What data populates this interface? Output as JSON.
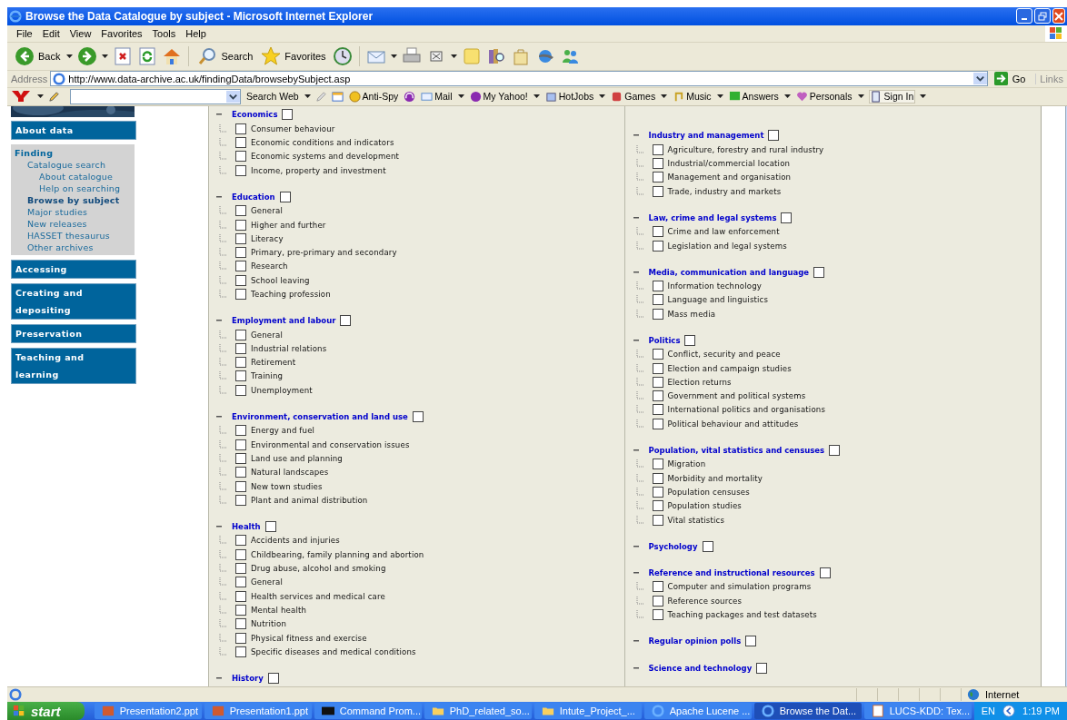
{
  "window": {
    "title": "Browse the Data Catalogue by subject - Microsoft Internet Explorer"
  },
  "menu": [
    "File",
    "Edit",
    "View",
    "Favorites",
    "Tools",
    "Help"
  ],
  "toolbar": {
    "back": "Back",
    "search": "Search",
    "favorites": "Favorites"
  },
  "address": {
    "label": "Address",
    "value": "http://www.data-archive.ac.uk/findingData/browsebySubject.asp",
    "go": "Go",
    "links": "Links"
  },
  "yahoo_toolbar": {
    "search_button": "Search Web",
    "buttons": [
      {
        "label": "Anti-Spy",
        "kind": "antispy",
        "dropdown": false
      },
      {
        "label": "Mail",
        "kind": "mail",
        "dropdown": true
      },
      {
        "label": "My Yahoo!",
        "kind": "my",
        "dropdown": true
      },
      {
        "label": "HotJobs",
        "kind": "jobs",
        "dropdown": true
      },
      {
        "label": "Games",
        "kind": "games",
        "dropdown": true
      },
      {
        "label": "Music",
        "kind": "music",
        "dropdown": true
      },
      {
        "label": "Answers",
        "kind": "answers",
        "dropdown": true
      },
      {
        "label": "Personals",
        "kind": "personals",
        "dropdown": true
      },
      {
        "label": "Sign In",
        "kind": "signin",
        "dropdown": true
      }
    ]
  },
  "sidebar": {
    "sections": [
      {
        "kind": "tab",
        "label": "About data"
      },
      {
        "kind": "group",
        "label": "Finding",
        "links": [
          {
            "label": "Catalogue search",
            "selected": false,
            "children": [
              {
                "label": "About catalogue",
                "selected": false
              },
              {
                "label": "Help on searching",
                "selected": false
              }
            ]
          },
          {
            "label": "Browse by subject",
            "selected": true
          },
          {
            "label": "Major studies",
            "selected": false
          },
          {
            "label": "New releases",
            "selected": false
          },
          {
            "label": "HASSET thesaurus",
            "selected": false
          },
          {
            "label": "Other archives",
            "selected": false
          }
        ]
      },
      {
        "kind": "tab",
        "label": "Accessing"
      },
      {
        "kind": "tab",
        "label": "Creating and depositing"
      },
      {
        "kind": "tab",
        "label": "Preservation"
      },
      {
        "kind": "tab",
        "label": "Teaching and learning"
      }
    ]
  },
  "columns": [
    {
      "categories": [
        {
          "title": "Economics",
          "checked": false,
          "items": [
            {
              "label": "Consumer behaviour",
              "checked": false
            },
            {
              "label": "Economic conditions and indicators",
              "checked": false
            },
            {
              "label": "Economic systems and development",
              "checked": false
            },
            {
              "label": "Income, property and investment",
              "checked": false
            }
          ]
        },
        {
          "title": "Education",
          "checked": false,
          "items": [
            {
              "label": "General",
              "checked": false
            },
            {
              "label": "Higher and further",
              "checked": false
            },
            {
              "label": "Literacy",
              "checked": false
            },
            {
              "label": "Primary, pre-primary and secondary",
              "checked": false
            },
            {
              "label": "Research",
              "checked": false
            },
            {
              "label": "School leaving",
              "checked": false
            },
            {
              "label": "Teaching profession",
              "checked": false
            }
          ]
        },
        {
          "title": "Employment and labour",
          "checked": false,
          "items": [
            {
              "label": "General",
              "checked": false
            },
            {
              "label": "Industrial relations",
              "checked": false
            },
            {
              "label": "Retirement",
              "checked": false
            },
            {
              "label": "Training",
              "checked": false
            },
            {
              "label": "Unemployment",
              "checked": false
            }
          ]
        },
        {
          "title": "Environment, conservation and land use",
          "checked": false,
          "items": [
            {
              "label": "Energy and fuel",
              "checked": false
            },
            {
              "label": "Environmental and conservation issues",
              "checked": false
            },
            {
              "label": "Land use and planning",
              "checked": false
            },
            {
              "label": "Natural landscapes",
              "checked": false
            },
            {
              "label": "New town studies",
              "checked": false
            },
            {
              "label": "Plant and animal distribution",
              "checked": false
            }
          ]
        },
        {
          "title": "Health",
          "checked": false,
          "items": [
            {
              "label": "Accidents and injuries",
              "checked": false
            },
            {
              "label": "Childbearing, family planning and abortion",
              "checked": false
            },
            {
              "label": "Drug abuse, alcohol and smoking",
              "checked": false
            },
            {
              "label": "General",
              "checked": false
            },
            {
              "label": "Health services and medical care",
              "checked": false
            },
            {
              "label": "Mental health",
              "checked": false
            },
            {
              "label": "Nutrition",
              "checked": false
            },
            {
              "label": "Physical fitness and exercise",
              "checked": false
            },
            {
              "label": "Specific diseases and medical conditions",
              "checked": false
            }
          ]
        },
        {
          "title": "History",
          "checked": false
        }
      ]
    },
    {
      "categories": [
        {
          "title": "Industry and management",
          "checked": false,
          "items": [
            {
              "label": "Agriculture, forestry and rural industry",
              "checked": false
            },
            {
              "label": "Industrial/commercial location",
              "checked": false
            },
            {
              "label": "Management and organisation",
              "checked": false
            },
            {
              "label": "Trade, industry and markets",
              "checked": false
            }
          ]
        },
        {
          "title": "Law, crime and legal systems",
          "checked": false,
          "items": [
            {
              "label": "Crime and law enforcement",
              "checked": false
            },
            {
              "label": "Legislation and legal systems",
              "checked": false
            }
          ]
        },
        {
          "title": "Media, communication and language",
          "checked": false,
          "items": [
            {
              "label": "Information technology",
              "checked": false
            },
            {
              "label": "Language and linguistics",
              "checked": false
            },
            {
              "label": "Mass media",
              "checked": false
            }
          ]
        },
        {
          "title": "Politics",
          "checked": false,
          "items": [
            {
              "label": "Conflict, security and peace",
              "checked": false
            },
            {
              "label": "Election and campaign studies",
              "checked": false
            },
            {
              "label": "Election returns",
              "checked": false
            },
            {
              "label": "Government and political systems",
              "checked": false
            },
            {
              "label": "International politics and organisations",
              "checked": false
            },
            {
              "label": "Political behaviour and attitudes",
              "checked": false
            }
          ]
        },
        {
          "title": "Population, vital statistics and censuses",
          "checked": false,
          "items": [
            {
              "label": "Migration",
              "checked": false
            },
            {
              "label": "Morbidity and mortality",
              "checked": false
            },
            {
              "label": "Population censuses",
              "checked": false
            },
            {
              "label": "Population studies",
              "checked": false
            },
            {
              "label": "Vital statistics",
              "checked": false
            }
          ]
        },
        {
          "title": "Psychology",
          "checked": false
        },
        {
          "title": "Reference and instructional resources",
          "checked": false,
          "items": [
            {
              "label": "Computer and simulation programs",
              "checked": false
            },
            {
              "label": "Reference sources",
              "checked": false
            },
            {
              "label": "Teaching packages and test datasets",
              "checked": false
            }
          ]
        },
        {
          "title": "Regular opinion polls",
          "checked": false
        },
        {
          "title": "Science and technology",
          "checked": false
        }
      ]
    }
  ],
  "status_bar": {
    "zone": "Internet"
  },
  "taskbar": {
    "start": "start",
    "tasks": [
      {
        "label": "Presentation2.ppt",
        "kind": "ppt",
        "selected": false
      },
      {
        "label": "Presentation1.ppt",
        "kind": "ppt",
        "selected": false
      },
      {
        "label": "Command Prom...",
        "kind": "cmd",
        "selected": false
      },
      {
        "label": "PhD_related_so...",
        "kind": "folder",
        "selected": false
      },
      {
        "label": "Intute_Project_...",
        "kind": "folder",
        "selected": false
      },
      {
        "label": "Apache Lucene ...",
        "kind": "ie",
        "selected": false
      },
      {
        "label": "Browse the Dat...",
        "kind": "ie",
        "selected": true
      },
      {
        "label": "LUCS-KDD: Tex...",
        "kind": "doc",
        "selected": false
      }
    ],
    "language": "EN",
    "clock": "1:19 PM"
  }
}
